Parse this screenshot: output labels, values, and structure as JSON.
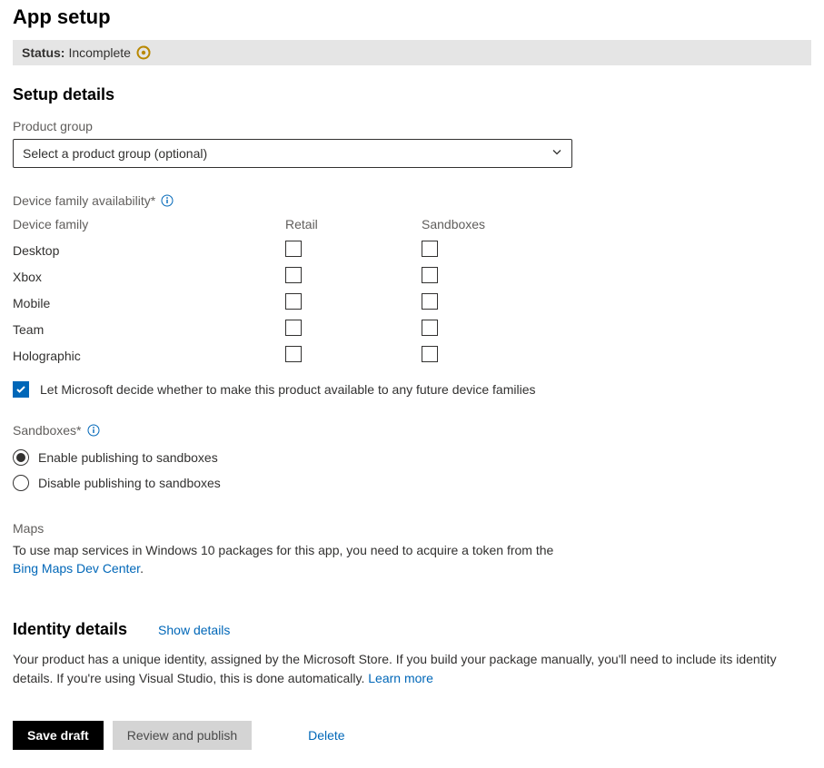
{
  "page": {
    "title": "App setup"
  },
  "status": {
    "label": "Status:",
    "value": "Incomplete"
  },
  "setupDetails": {
    "heading": "Setup details",
    "productGroup": {
      "label": "Product group",
      "selected": "Select a product group (optional)"
    },
    "deviceFamily": {
      "label": "Device family availability*",
      "columns": {
        "c1": "Device family",
        "c2": "Retail",
        "c3": "Sandboxes"
      },
      "rows": [
        {
          "name": "Desktop",
          "retail": false,
          "sandboxes": false
        },
        {
          "name": "Xbox",
          "retail": false,
          "sandboxes": false
        },
        {
          "name": "Mobile",
          "retail": false,
          "sandboxes": false
        },
        {
          "name": "Team",
          "retail": false,
          "sandboxes": false
        },
        {
          "name": "Holographic",
          "retail": false,
          "sandboxes": false
        }
      ],
      "futureFamilies": {
        "checked": true,
        "label": "Let Microsoft decide whether to make this product available to any future device families"
      }
    },
    "sandboxes": {
      "label": "Sandboxes*",
      "options": {
        "enable": "Enable publishing to sandboxes",
        "disable": "Disable publishing to sandboxes"
      },
      "selected": "enable"
    },
    "maps": {
      "heading": "Maps",
      "bodyPrefix": "To use map services in Windows 10 packages for this app, you need to acquire a token from the ",
      "linkText": "Bing Maps Dev Center",
      "bodySuffix": "."
    }
  },
  "identity": {
    "heading": "Identity details",
    "showDetails": "Show details",
    "description": "Your product has a unique identity, assigned by the Microsoft Store. If you build your package manually, you'll need to include its identity details. If you're using Visual Studio, this is done automatically. ",
    "learnMore": "Learn more"
  },
  "actions": {
    "saveDraft": "Save draft",
    "reviewPublish": "Review and publish",
    "delete": "Delete"
  }
}
